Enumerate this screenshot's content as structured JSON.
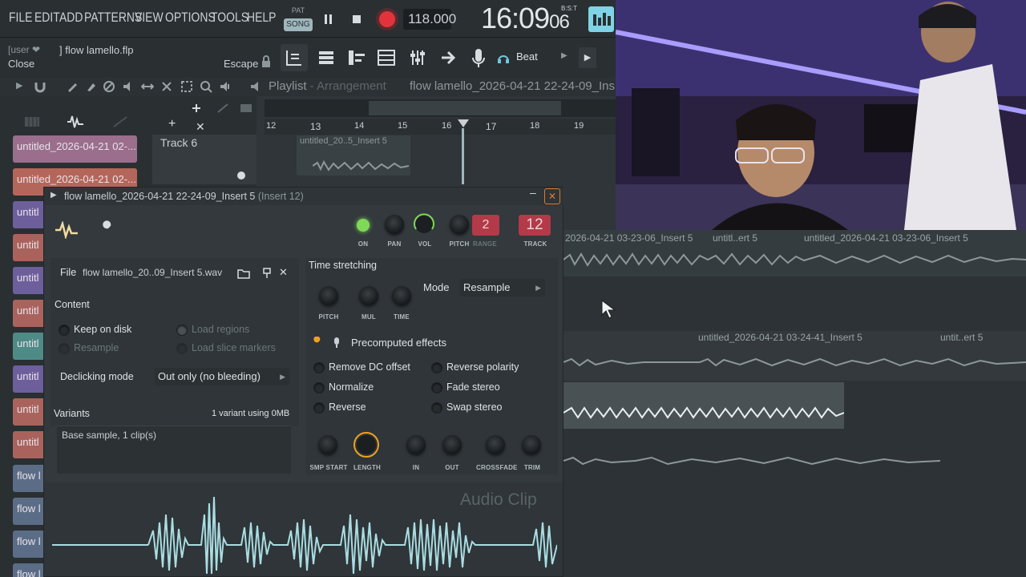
{
  "menu": [
    "FILE",
    "EDIT",
    "ADD",
    "PATTERNS",
    "VIEW",
    "OPTIONS",
    "TOOLS",
    "HELP"
  ],
  "transport": {
    "pat_label": "PAT",
    "song_label": "SONG",
    "tempo": "118.000",
    "time": "16:09",
    "time_small": "06",
    "time_zone": "B:S:T"
  },
  "hint": {
    "user": "[user ❤",
    "file": "] flow lamello.flp",
    "close": "Close",
    "escape": "Escape"
  },
  "toolbar": {
    "preset": "Beat"
  },
  "playlist": {
    "title": "Playlist",
    "sep": " - ",
    "sub": "Arrangement",
    "file": "flow lamello_2026-04-21 22-24-09_Ins"
  },
  "ruler": [
    "12",
    "13",
    "14",
    "15",
    "16",
    "17",
    "18",
    "19"
  ],
  "track6": {
    "name": "Track 6",
    "clip": "untitled_20..5_Insert 5"
  },
  "left_clips": [
    "untitled_2026-04-21 02-...",
    "untitled_2026-04-21 02-...",
    "untitl",
    "untitl",
    "untitl",
    "untitl",
    "untitl",
    "untitl",
    "untitl",
    "untitl",
    "flow l",
    "flow l",
    "flow l",
    "flow l"
  ],
  "grid_clips": {
    "row1": [
      "2026-04-21 03-23-06_Insert 5",
      "untitl..ert 5",
      "untitled_2026-04-21 03-23-06_Insert 5"
    ],
    "row3": [
      "untitled_2026-04-21 03-24-41_Insert 5",
      "untit..ert 5"
    ]
  },
  "plugin": {
    "title": "flow lamello_2026-04-21 22-24-09_Insert 5",
    "insert": "(Insert 12)",
    "knob_labels": {
      "on": "ON",
      "pan": "PAN",
      "vol": "VOL",
      "pitch": "PITCH",
      "range": "RANGE",
      "track": "TRACK"
    },
    "range_value": "2",
    "track_value": "12",
    "file_label": "File",
    "file_name": "flow lamello_20..09_Insert 5.wav",
    "content_heading": "Content",
    "keep_on_disk": "Keep on disk",
    "resample": "Resample",
    "load_regions": "Load regions",
    "load_slice_markers": "Load slice markers",
    "declicking_label": "Declicking mode",
    "declicking_value": "Out only (no bleeding)",
    "variants_heading": "Variants",
    "variants_info": "1 variant using 0MB",
    "variants_item": "Base sample, 1 clip(s)",
    "time_stretching": "Time stretching",
    "ts_knobs": [
      "PITCH",
      "MUL",
      "TIME"
    ],
    "mode_label": "Mode",
    "mode_value": "Resample",
    "precomputed": "Precomputed effects",
    "effects_left": [
      "Remove DC offset",
      "Normalize",
      "Reverse"
    ],
    "effects_right": [
      "Reverse polarity",
      "Fade stereo",
      "Swap stereo"
    ],
    "bottom_knobs": [
      "SMP START",
      "LENGTH",
      "IN",
      "OUT",
      "CROSSFADE",
      "TRIM"
    ],
    "watermark": "Audio Clip"
  },
  "colors": {
    "accent_green": "#7ed957",
    "record": "#e2333d",
    "track_red": "#c0304a",
    "orange_knob": "#f0a020",
    "waveform": "#a9dde3"
  }
}
